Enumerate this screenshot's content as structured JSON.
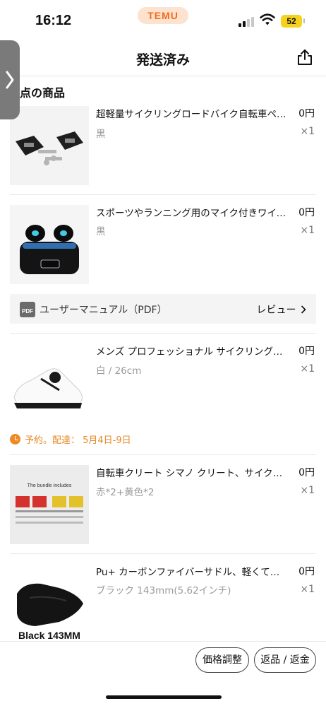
{
  "status_bar": {
    "time": "16:12",
    "app_badge": "TEMU",
    "battery": "52"
  },
  "header": {
    "title": "発送済み"
  },
  "section_title": "点の商品",
  "products": [
    {
      "name": "超軽量サイクリングロードバイク自転車ペダル",
      "price": "0円",
      "variant": "黒",
      "qty": "×1"
    },
    {
      "name": "スポーツやランニング用のマイク付きワイヤレスイヤホン",
      "price": "0円",
      "variant": "黒",
      "qty": "×1"
    },
    {
      "name": "メンズ プロフェッショナル サイクリングシューズ",
      "price": "0円",
      "variant": "白 / 26cm",
      "qty": "×1"
    },
    {
      "name": "自転車クリート シマノ クリート、サイクリング用",
      "price": "0円",
      "variant": "赤*2+黄色*2",
      "qty": "×1",
      "image_caption": "The bundle includes"
    },
    {
      "name": "Pu+ カーボンファイバーサドル、軽くて快適",
      "price": "0円",
      "variant": "ブラック 143mm(5.62インチ)",
      "qty": "×1",
      "image_label": "Black 143MM"
    }
  ],
  "manual": {
    "pdf_badge": "PDF",
    "label": "ユーザーマニュアル（PDF）",
    "review": "レビュー"
  },
  "reservation": {
    "text": "予約。配達： 5月4日-9日"
  },
  "buttons": {
    "price_adjust": "価格調整",
    "return_refund": "返品 / 返金"
  },
  "colors": {
    "accent_orange": "#f56a1a",
    "reserve_orange": "#e88a25",
    "battery_yellow": "#f7d21d"
  },
  "icons": [
    "signal-icon",
    "wifi-icon",
    "share-icon",
    "chevron-right-icon",
    "pdf-icon",
    "clock-check-icon"
  ]
}
